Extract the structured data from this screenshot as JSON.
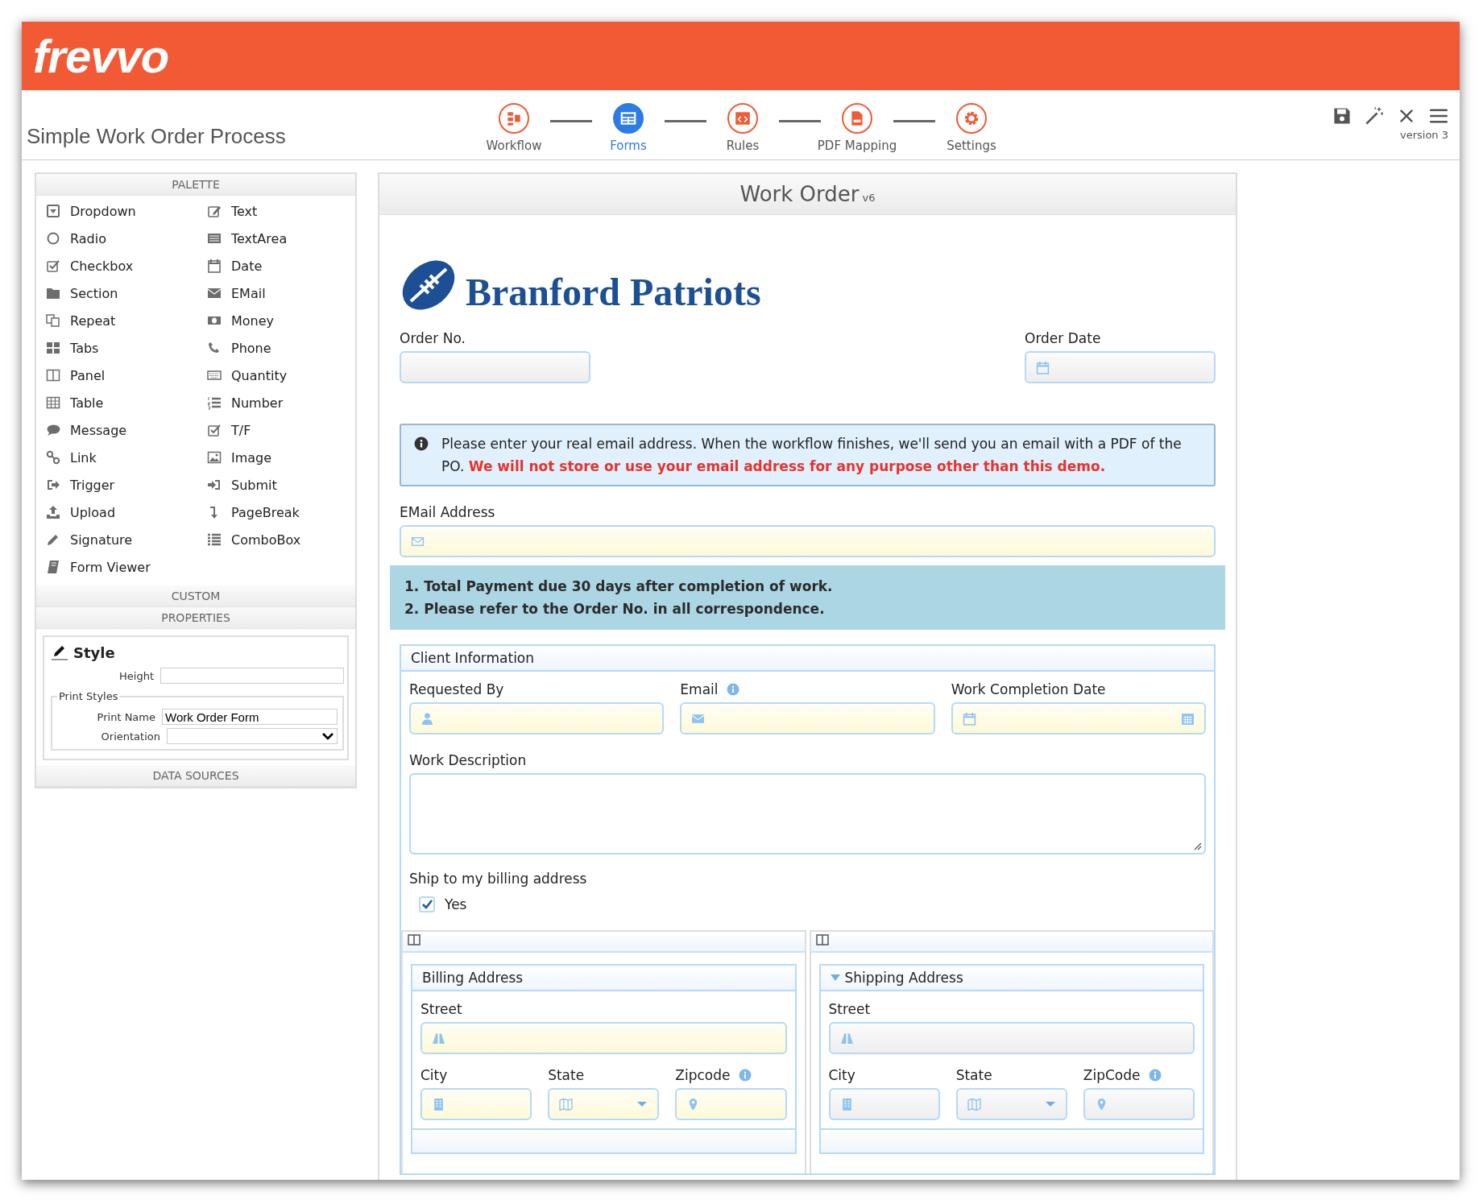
{
  "app": {
    "logo": "frevvo"
  },
  "toolbar": {
    "title": "Simple Work Order Process",
    "version": "version 3",
    "steps": [
      {
        "label": "Workflow",
        "selected": false
      },
      {
        "label": "Forms",
        "selected": true
      },
      {
        "label": "Rules",
        "selected": false
      },
      {
        "label": "PDF Mapping",
        "selected": false
      },
      {
        "label": "Settings",
        "selected": false
      }
    ]
  },
  "palette": {
    "title": "PALETTE",
    "items": [
      {
        "label": "Dropdown"
      },
      {
        "label": "Text"
      },
      {
        "label": "Radio"
      },
      {
        "label": "TextArea"
      },
      {
        "label": "Checkbox"
      },
      {
        "label": "Date"
      },
      {
        "label": "Section"
      },
      {
        "label": "EMail"
      },
      {
        "label": "Repeat"
      },
      {
        "label": "Money"
      },
      {
        "label": "Tabs"
      },
      {
        "label": "Phone"
      },
      {
        "label": "Panel"
      },
      {
        "label": "Quantity"
      },
      {
        "label": "Table"
      },
      {
        "label": "Number"
      },
      {
        "label": "Message"
      },
      {
        "label": "T/F"
      },
      {
        "label": "Link"
      },
      {
        "label": "Image"
      },
      {
        "label": "Trigger"
      },
      {
        "label": "Submit"
      },
      {
        "label": "Upload"
      },
      {
        "label": "PageBreak"
      },
      {
        "label": "Signature"
      },
      {
        "label": "ComboBox"
      },
      {
        "label": "Form Viewer"
      }
    ],
    "custom_header": "CUSTOM"
  },
  "properties": {
    "header": "PROPERTIES",
    "heading": "Style",
    "height_label": "Height",
    "print_styles": {
      "legend": "Print Styles",
      "print_name_label": "Print Name",
      "print_name_value": "Work Order Form",
      "orientation_label": "Orientation"
    }
  },
  "data_sources": {
    "header": "DATA SOURCES"
  },
  "form": {
    "title": "Work Order",
    "version": "v6",
    "org_name": "Branford Patriots",
    "order_no": {
      "label": "Order No.",
      "required": false
    },
    "order_date": {
      "label": "Order Date",
      "required": false
    },
    "notice": "Please enter your real email address. When the workflow finishes, we'll send you an email with a PDF of the PO. **We will not store or use your email address for any purpose other than this demo.**",
    "email": {
      "label": "EMail Address",
      "required": true
    },
    "terms": [
      "1. Total Payment due 30 days after completion of work.",
      "2. Please refer to the Order No. in all correspondence."
    ],
    "client": {
      "title": "Client Information",
      "fields": [
        {
          "label": "Requested By",
          "kind": "person",
          "info": false,
          "required": true
        },
        {
          "label": "Email",
          "kind": "email",
          "info": true,
          "required": true
        },
        {
          "label": "Work Completion Date",
          "kind": "date",
          "info": false,
          "required": true
        }
      ],
      "description_label": "Work Description",
      "ship_label": "Ship to my billing address",
      "ship_option": {
        "label": "Yes",
        "checked": true
      }
    },
    "addresses": [
      {
        "title": "Billing Address",
        "collapsible": false,
        "street": {
          "label": "Street",
          "required": true
        },
        "fields": [
          {
            "label": "City",
            "kind": "city",
            "info": false,
            "required": true
          },
          {
            "label": "State",
            "kind": "state",
            "info": false,
            "required": true
          },
          {
            "label": "Zipcode",
            "kind": "zip",
            "info": true,
            "required": true
          }
        ]
      },
      {
        "title": "Shipping Address",
        "collapsible": true,
        "street": {
          "label": "Street",
          "required": false
        },
        "fields": [
          {
            "label": "City",
            "kind": "city",
            "info": false,
            "required": false
          },
          {
            "label": "State",
            "kind": "state",
            "info": false,
            "required": false
          },
          {
            "label": "ZipCode",
            "kind": "zip",
            "info": true,
            "required": false
          }
        ]
      }
    ]
  }
}
